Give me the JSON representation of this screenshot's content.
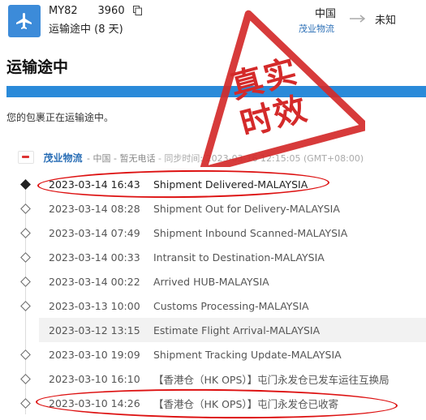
{
  "shipment": {
    "tracking_number": "MY82   3960",
    "status_days": "运输途中 (8 天)",
    "origin": "中国",
    "carrier_short": "茂业物流",
    "destination": "未知"
  },
  "page": {
    "title": "运输途中",
    "progress_fraction": 1.0,
    "intro": "您的包裹正在运输途中。"
  },
  "carrier_row": {
    "name": "茂业物流",
    "meta": " - 中国 - 暂无电话",
    "refresh": " - 同步时间: 2023-03-16 12:15:05 (GMT+08:00)"
  },
  "events": [
    {
      "time": "2023-03-14 16:43",
      "desc": "Shipment Delivered-MALAYSIA"
    },
    {
      "time": "2023-03-14 08:28",
      "desc": "Shipment Out for Delivery-MALAYSIA"
    },
    {
      "time": "2023-03-14 07:49",
      "desc": "Shipment Inbound Scanned-MALAYSIA"
    },
    {
      "time": "2023-03-14 00:33",
      "desc": "Intransit to Destination-MALAYSIA"
    },
    {
      "time": "2023-03-14 00:22",
      "desc": "Arrived HUB-MALAYSIA"
    },
    {
      "time": "2023-03-13 10:00",
      "desc": "Customs Processing-MALAYSIA"
    },
    {
      "time": "2023-03-12 13:15",
      "desc": "Estimate Flight Arrival-MALAYSIA"
    },
    {
      "time": "2023-03-10 19:09",
      "desc": "Shipment Tracking Update-MALAYSIA"
    },
    {
      "time": "2023-03-10 16:10",
      "desc": "【香港仓（HK OPS）】屯门永发仓已发车运往互换局"
    },
    {
      "time": "2023-03-10 14:26",
      "desc": "【香港仓（HK OPS）】屯门永发仓已收寄"
    }
  ],
  "stamp": {
    "line1": "真实",
    "line2": "时效",
    "color": "#d42a2a"
  },
  "colors": {
    "accent": "#2a8ad9",
    "annotation": "#d11111"
  },
  "icons": {
    "status": "airplane-icon",
    "copy": "copy-icon",
    "arrow": "arrow-right-icon",
    "carrier": "carrier-logo",
    "stamp": "stamp-badge"
  }
}
